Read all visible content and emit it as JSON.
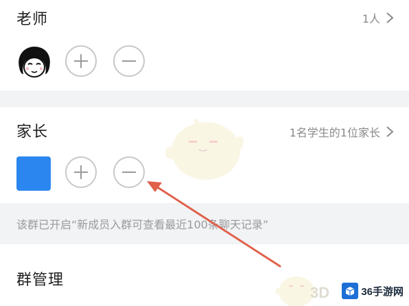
{
  "teacher_section": {
    "title": "老师",
    "count_label": "1人",
    "add_icon": "plus-icon",
    "remove_icon": "minus-icon"
  },
  "parent_section": {
    "title": "家长",
    "summary_label": "1名学生的1位家长",
    "avatar_color": "#2b87ef",
    "add_icon": "plus-icon",
    "remove_icon": "minus-icon"
  },
  "notice": {
    "text": "该群已开启“新成员入群可查看最近100条聊天记录”"
  },
  "group_manage": {
    "title": "群管理"
  },
  "watermark": {
    "brand_text": "36手游网",
    "faint_text": "3D"
  },
  "colors": {
    "background": "#ffffff",
    "gap": "#f2f3f5",
    "arrow": "#e0604a",
    "circle_border": "#c9c9c9"
  }
}
